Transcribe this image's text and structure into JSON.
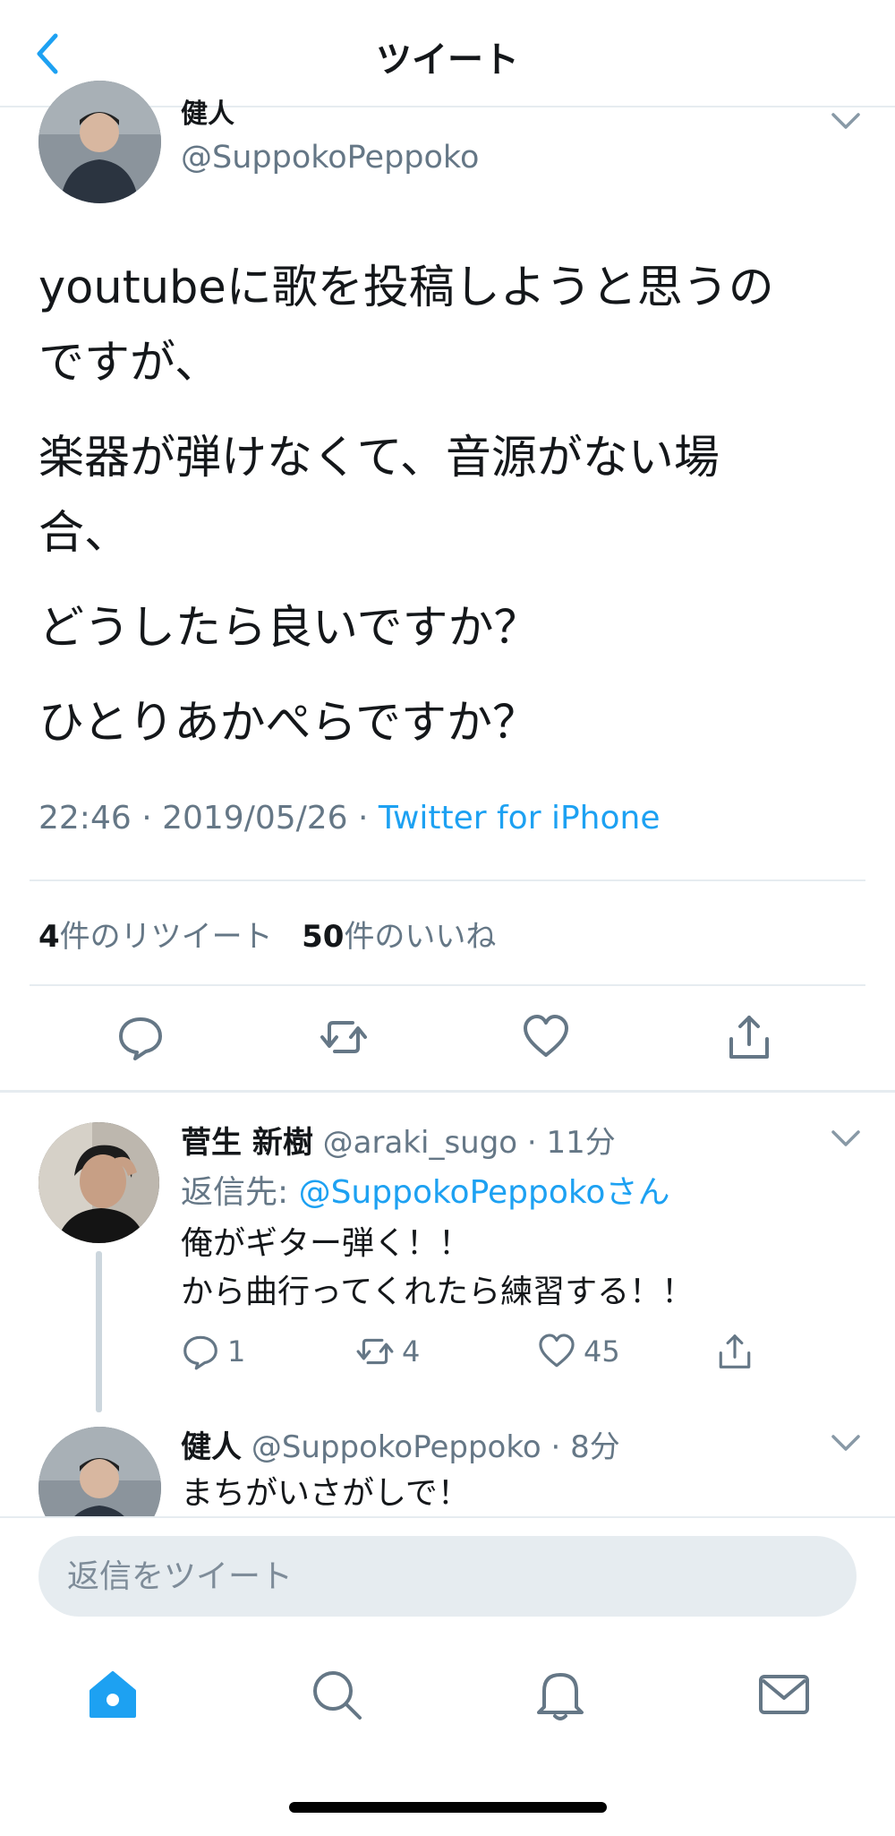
{
  "header": {
    "title": "ツイート",
    "back_icon": "chevron-left-icon"
  },
  "main_tweet": {
    "display_name": "健人",
    "handle": "@SuppokoPeppoko",
    "paragraphs": [
      {
        "line1": "youtubeに歌を投稿しようと思うの",
        "line2": "ですが、"
      },
      {
        "line1": "楽器が弾けなくて、音源がない場",
        "line2": "合、"
      },
      {
        "line1": "どうしたら良いですか？"
      },
      {
        "line1": "ひとりあかぺらですか？"
      }
    ],
    "timestamp": "22:46 · 2019/05/26 · ",
    "source": "Twitter for iPhone",
    "retweet_count": "4",
    "retweet_label": "件のリツイート",
    "like_count": "50",
    "like_label": "件のいいね"
  },
  "reply": {
    "display_name": "菅生 新樹",
    "handle_time": "@araki_sugo · 11分",
    "reply_to_label": "返信先: ",
    "reply_to_handle": "@SuppokoPeppokoさん",
    "lines": [
      "俺がギター弾く！！",
      "から曲行ってくれたら練習する！！"
    ],
    "reply_count": "1",
    "retweet_count": "4",
    "like_count": "45"
  },
  "reply2": {
    "display_name": "健人",
    "handle_time": "@SuppokoPeppoko · 8分",
    "text": "まちがいさがしで！"
  },
  "compose": {
    "placeholder": "返信をツイート"
  },
  "colors": {
    "accent": "#1da1f2",
    "muted": "#657786",
    "divider": "#e6ecf0"
  }
}
